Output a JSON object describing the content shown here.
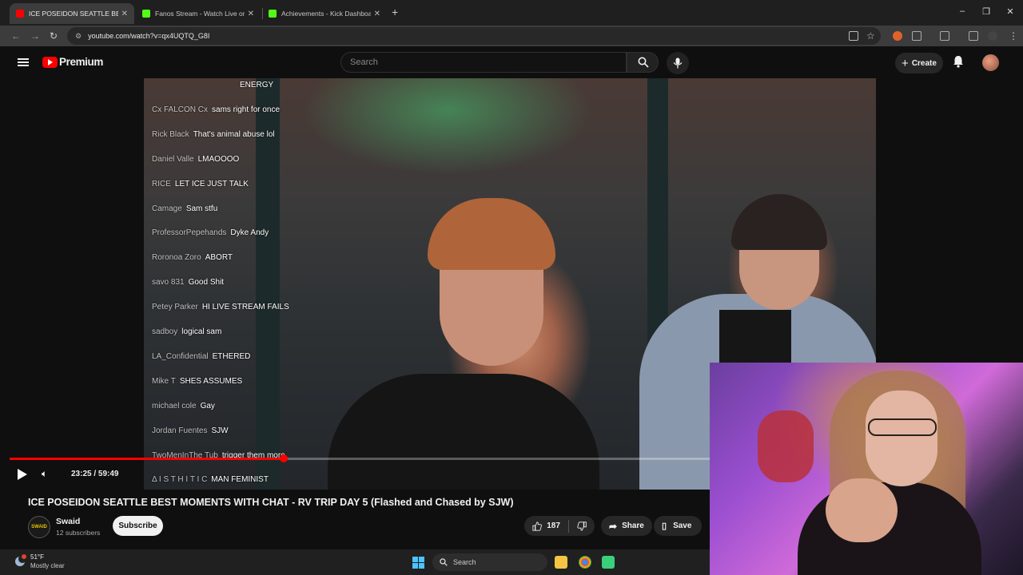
{
  "browser": {
    "tabs": [
      {
        "title": "ICE POSEIDON SEATTLE BEST M",
        "active": true,
        "favicon_color": "#ff0000"
      },
      {
        "title": "Fanos Stream - Watch Live on K",
        "active": false,
        "favicon_color": "#53fc18"
      },
      {
        "title": "Achievements - Kick Dashboard",
        "active": false,
        "favicon_color": "#53fc18"
      }
    ],
    "url": "youtube.com/watch?v=qx4UQTQ_G8I"
  },
  "youtube": {
    "brand": "Premium",
    "search_placeholder": "Search",
    "create_label": "Create"
  },
  "player": {
    "chat": [
      {
        "user": "",
        "msg": "ENERGY"
      },
      {
        "user": "Cx FALCON Cx",
        "msg": "sams right for once"
      },
      {
        "user": "Rick Black",
        "msg": "That's animal abuse lol"
      },
      {
        "user": "Daniel Valle",
        "msg": "LMAOOOO"
      },
      {
        "user": "RICE",
        "msg": "LET ICE JUST TALK"
      },
      {
        "user": "Camage",
        "msg": "Sam stfu"
      },
      {
        "user": "ProfessorPepehands",
        "msg": "Dyke Andy"
      },
      {
        "user": "Roronoa Zoro",
        "msg": "ABORT"
      },
      {
        "user": "savo 831",
        "msg": "Good Shit"
      },
      {
        "user": "Petey Parker",
        "msg": "HI LIVE STREAM FAILS"
      },
      {
        "user": "sadboy",
        "msg": "logical sam"
      },
      {
        "user": "LA_Confidential",
        "msg": "ETHERED"
      },
      {
        "user": "Mike T",
        "msg": "SHES ASSUMES"
      },
      {
        "user": "michael cole",
        "msg": "Gay"
      },
      {
        "user": "Jordan Fuentes",
        "msg": "SJW"
      },
      {
        "user": "TwoMenInThe Tub",
        "msg": "trigger them more"
      },
      {
        "user": "Δ I S T H I T I C",
        "msg": "MAN FEMINIST"
      }
    ],
    "time_display": "23:25 / 59:49",
    "progress": 0.3915
  },
  "video": {
    "title": "ICE POSEIDON SEATTLE BEST MOMENTS WITH CHAT - RV TRIP DAY 5 (Flashed and Chased by SJW)",
    "channel_name": "Swaid",
    "channel_avatar_text": "SWAID",
    "subscribers": "12 subscribers",
    "subscribe_label": "Subscribe",
    "likes": "187",
    "share_label": "Share",
    "save_label": "Save"
  },
  "taskbar": {
    "weather_temp": "51°F",
    "weather_desc": "Mostly clear",
    "search_label": "Search"
  },
  "colors": {
    "accent_red": "#ff0000",
    "kick_green": "#53fc18",
    "background": "#0f0f0f"
  }
}
